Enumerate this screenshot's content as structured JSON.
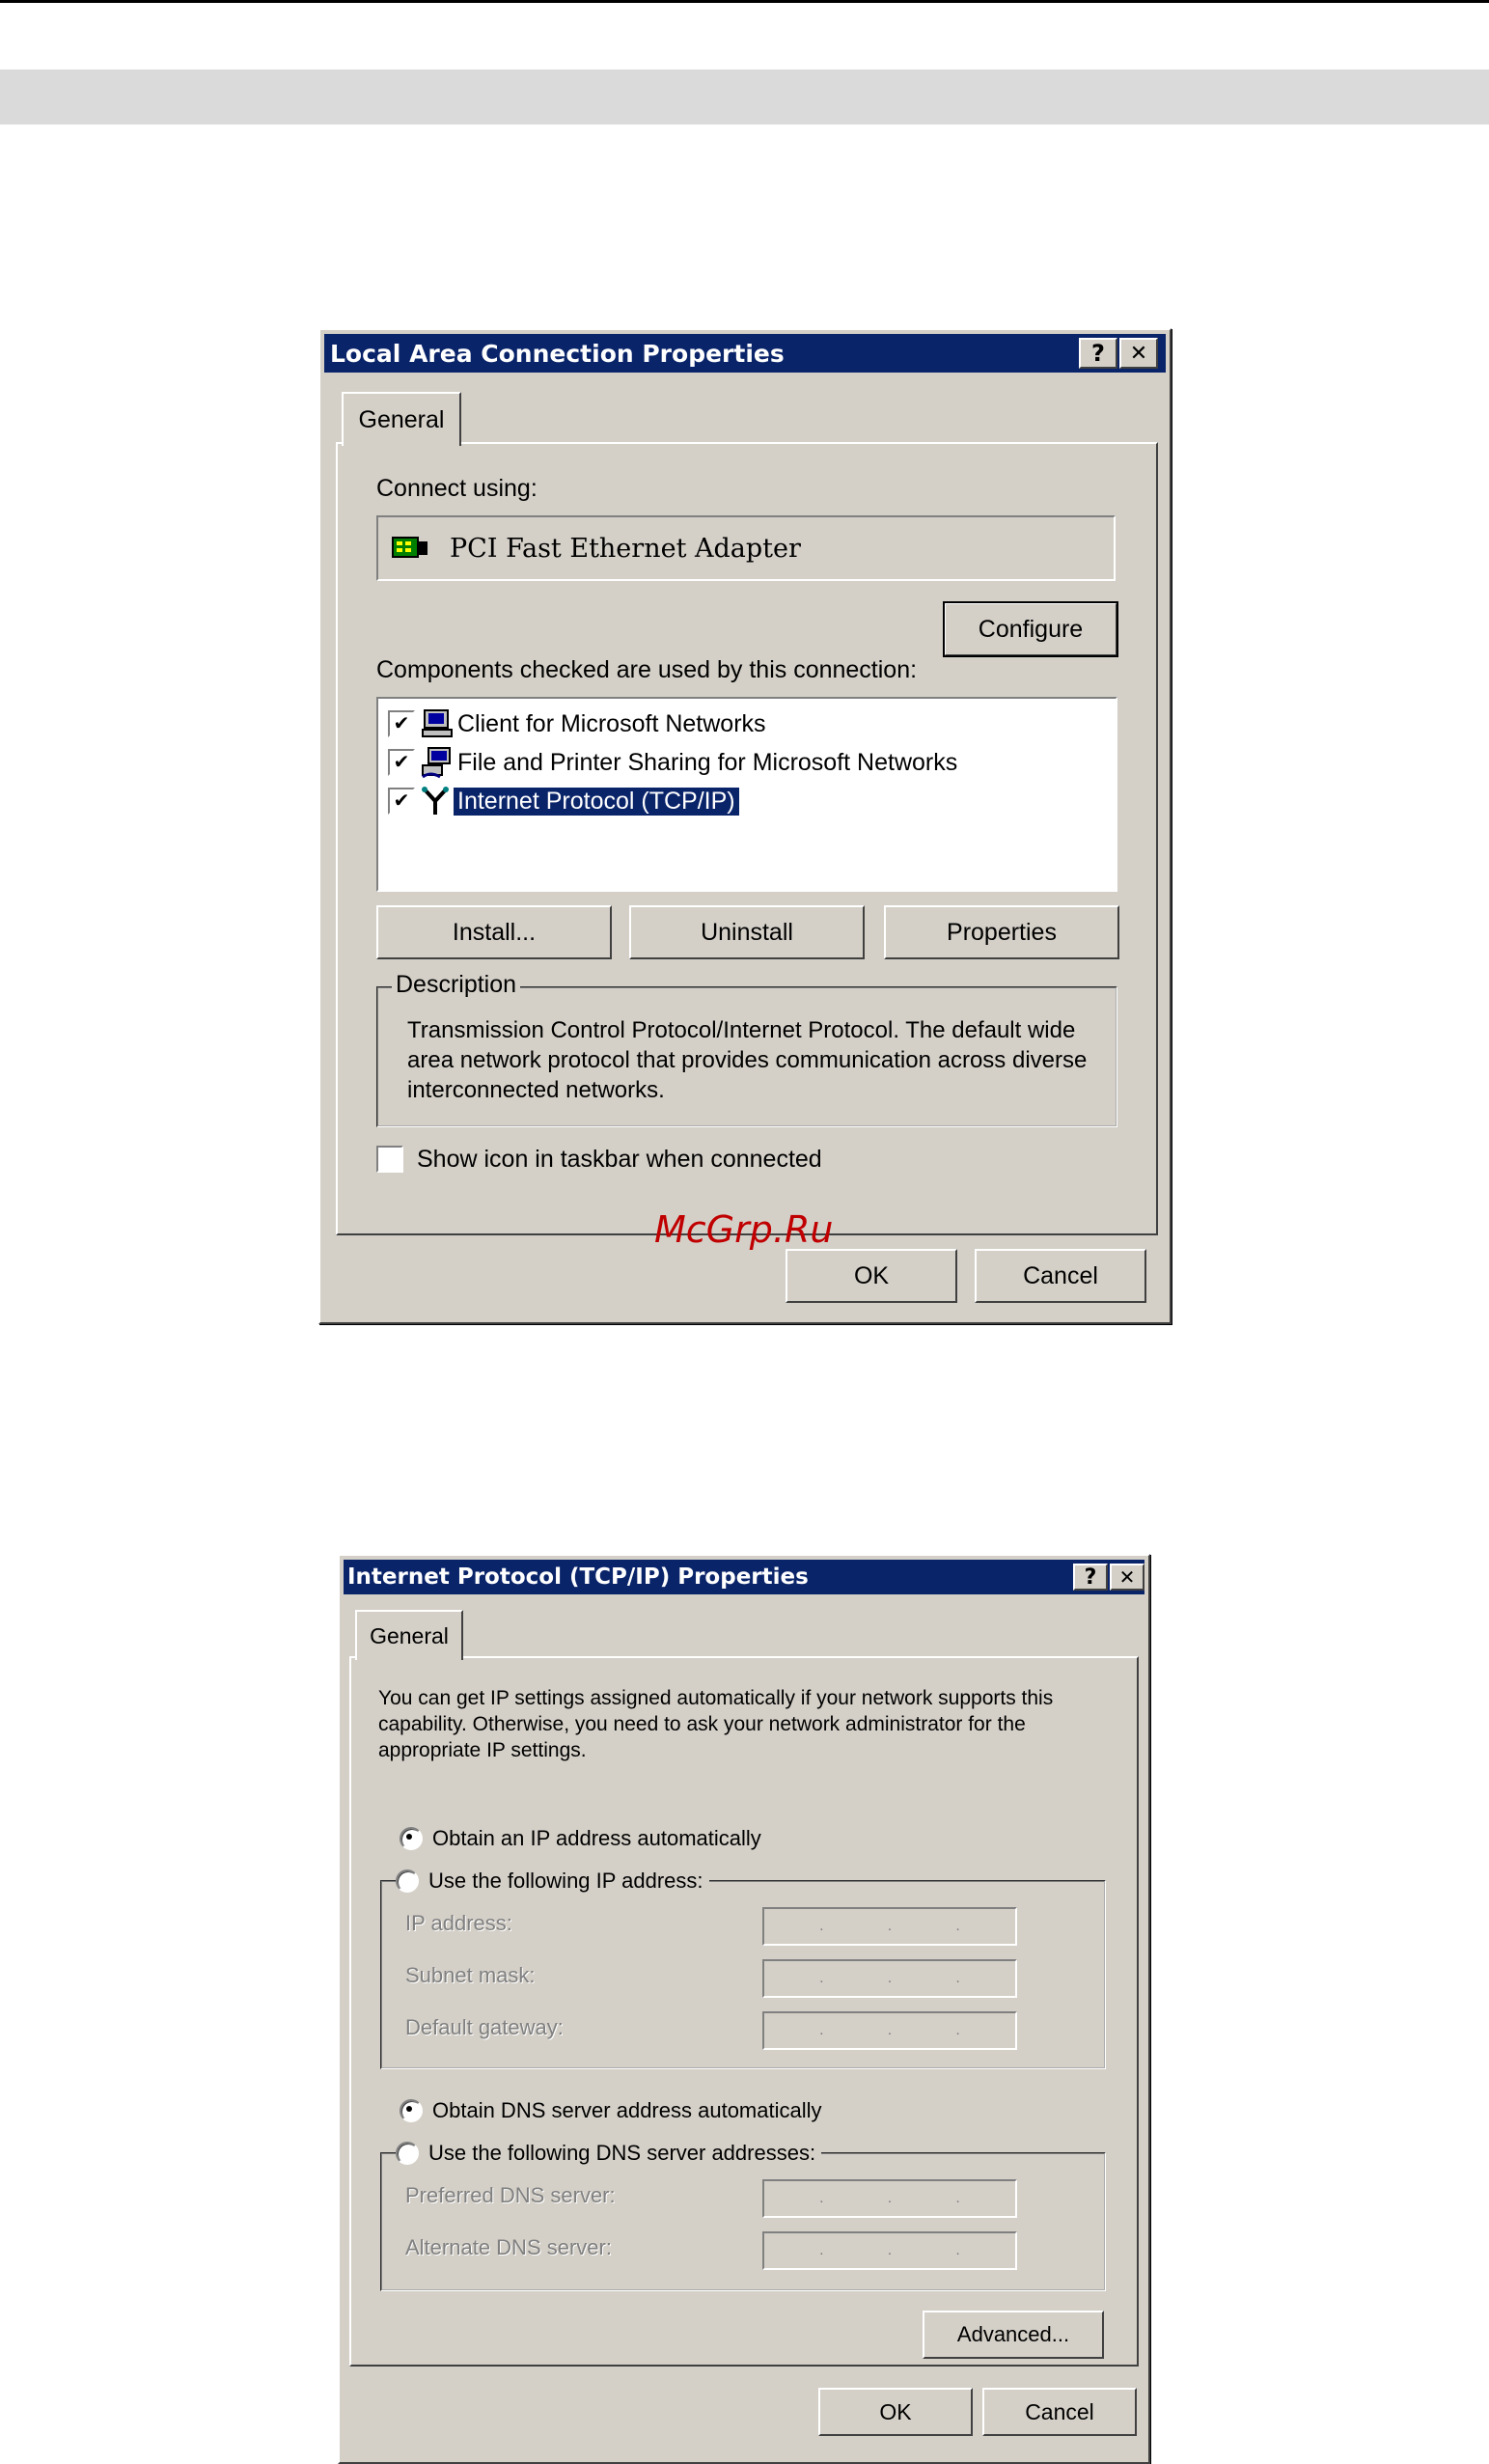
{
  "dialog1": {
    "title": "Local Area Connection Properties",
    "help_btn": "?",
    "close_btn": "✕",
    "tab": "General",
    "connect_using_label": "Connect using:",
    "adapter_name": "PCI Fast Ethernet Adapter",
    "configure_btn": "Configure",
    "components_label": "Components checked are used by this connection:",
    "components": [
      {
        "label": "Client for Microsoft Networks",
        "checked": "✔"
      },
      {
        "label": "File and Printer Sharing for Microsoft Networks",
        "checked": "✔"
      },
      {
        "label": "Internet Protocol (TCP/IP)",
        "checked": "✔"
      }
    ],
    "install_btn": "Install...",
    "uninstall_btn": "Uninstall",
    "properties_btn": "Properties",
    "description_legend": "Description",
    "description_text": "Transmission Control Protocol/Internet Protocol. The default wide area network protocol that provides communication across diverse interconnected networks.",
    "taskbar_label": "Show icon in taskbar when connected",
    "ok_btn": "OK",
    "cancel_btn": "Cancel"
  },
  "watermark": "McGrp.Ru",
  "dialog2": {
    "title": "Internet Protocol (TCP/IP) Properties",
    "help_btn": "?",
    "close_btn": "✕",
    "tab": "General",
    "intro": "You can get IP settings assigned automatically if your network supports this capability. Otherwise, you need to ask your network administrator for the appropriate IP settings.",
    "obtain_ip_label": "Obtain an IP address automatically",
    "use_ip_label": "Use the following IP address:",
    "ip_address_label": "IP address:",
    "subnet_label": "Subnet mask:",
    "gateway_label": "Default gateway:",
    "obtain_dns_label": "Obtain DNS server address automatically",
    "use_dns_label": "Use the following DNS server addresses:",
    "preferred_dns_label": "Preferred DNS server:",
    "alternate_dns_label": "Alternate DNS server:",
    "ip_dot": ".",
    "advanced_btn": "Advanced...",
    "ok_btn": "OK",
    "cancel_btn": "Cancel"
  }
}
